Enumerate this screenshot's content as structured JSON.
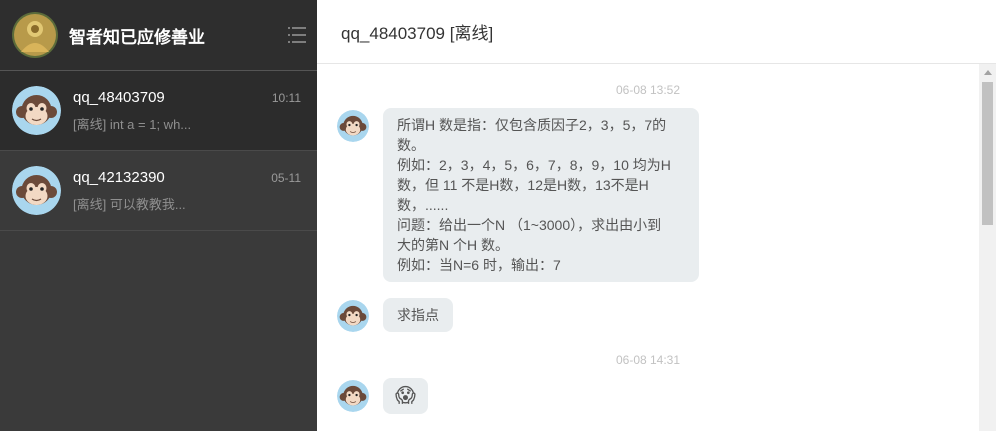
{
  "sidebar": {
    "user_name": "智者知已应修善业",
    "conversations": [
      {
        "name": "qq_48403709",
        "time": "10:11",
        "preview": "[离线] int a = 1; wh..."
      },
      {
        "name": "qq_42132390",
        "time": "05-11",
        "preview": "[离线] 可以教教我..."
      }
    ]
  },
  "chat": {
    "title": "qq_48403709 [离线]",
    "sep1": "06-08 13:52",
    "msg1_lines": [
      "所谓H 数是指：仅包含质因子2，3，5，7的",
      "数。",
      "例如：2，3，4，5，6，7，8，9，10 均为H",
      "数，但 11 不是H数，12是H数，13不是H",
      "数，......",
      "问题：给出一个N （1~3000），求出由小到",
      "大的第N 个H 数。",
      "例如：当N=6 时，输出：7"
    ],
    "msg2": "求指点",
    "sep2": "06-08 14:31",
    "msg3": "😱"
  },
  "colors": {
    "sidebar_bg": "#3a3a3a",
    "active_conv": "#2c2c2c",
    "bubble": "#e9edef"
  },
  "icons": [
    "menu-icon",
    "monkey-avatar",
    "profile-avatar",
    "scroll-up-icon"
  ]
}
